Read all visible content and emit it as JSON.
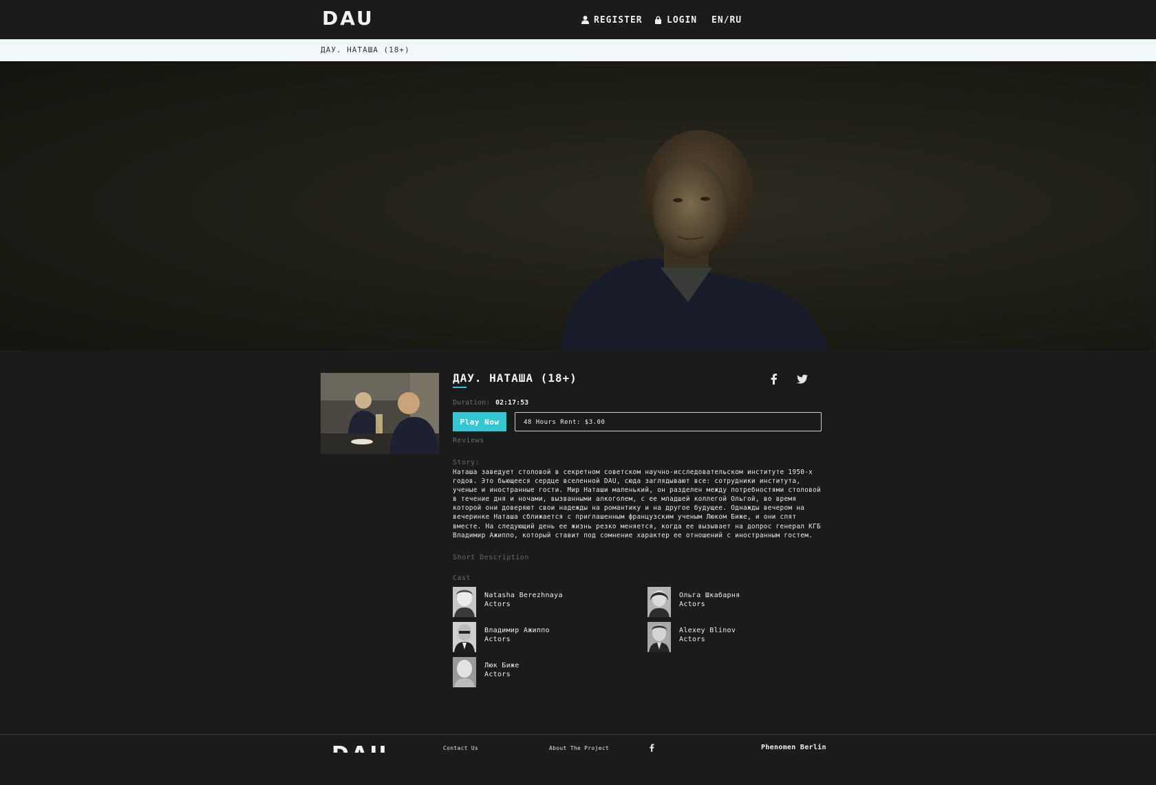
{
  "header": {
    "logo": "DAU",
    "register_label": "REGISTER",
    "login_label": "LOGIN",
    "lang_label": "EN/RU"
  },
  "breadcrumb": "ДАУ. НАТАША (18+)",
  "film": {
    "title": "ДАУ. НАТАША (18+)",
    "duration_label": "Duration:",
    "duration_value": "02:17:53",
    "play_label": "Play Now",
    "rent_label": "48 Hours Rent: $3.00",
    "reviews_label": "Reviews",
    "story_label": "Story:",
    "story_text": "Наташа заведует столовой в секретном советском научно-исследовательском институте 1950-х годов. Это бьющееся сердце вселенной DAU, сюда заглядывают все: сотрудники института, ученые и иностранные гости. Мир Наташи маленький, он разделен между потребностями столовой в течение дня и ночами, вызванными алкоголем, с ее младшей коллегой Ольгой, во время которой они доверяют свои надежды на романтику и на другое будущее. Однажды вечером на вечеринке Наташа сближается с приглашенным французским ученым Люком Биже, и они спят вместе. На следующий день ее жизнь резко меняется, когда ее вызывает на допрос генерал КГБ Владимир Ажиппо, который ставит под сомнение характер ее отношений с иностранным гостем.",
    "short_desc_label": "Short Description",
    "cast_label": "Cast",
    "cast": [
      {
        "name": "Natasha Berezhnaya",
        "role": "Actors"
      },
      {
        "name": "Ольга Шкабарня",
        "role": "Actors"
      },
      {
        "name": "Владимир Ажиппо",
        "role": "Actors"
      },
      {
        "name": "Alexey Blinov",
        "role": "Actors"
      },
      {
        "name": "Люк Биже",
        "role": "Actors"
      }
    ]
  },
  "footer": {
    "logo": "DAU",
    "contact_label": "Contact Us",
    "about_label": "About The Project",
    "phenomen_label": "Phenomen Berlin"
  },
  "icons": {
    "register": "user-icon",
    "login": "lock-icon",
    "facebook": "facebook-icon",
    "twitter": "twitter-icon"
  },
  "colors": {
    "background": "#1b1b1b",
    "accent": "#35c6d4",
    "breadcrumb_bg": "#f1f6f8"
  }
}
